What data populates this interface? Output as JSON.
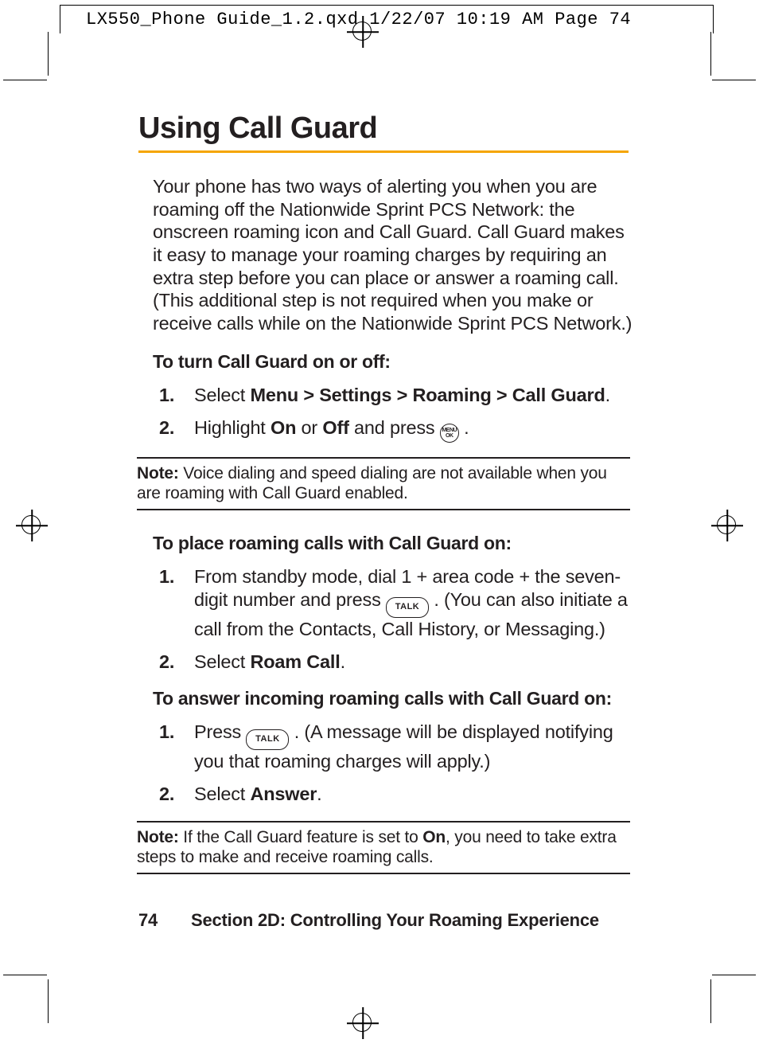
{
  "slug": "LX550_Phone Guide_1.2.qxd  1/22/07  10:19 AM  Page 74",
  "title": "Using Call Guard",
  "intro": "Your phone has two ways of alerting you when you are roaming off the Nationwide Sprint PCS Network: the onscreen roaming icon and Call Guard. Call Guard makes it easy to manage your roaming charges by requiring an extra step before you can place or answer a roaming call. (This additional step is not required when you make or receive calls while on the Nationwide Sprint PCS Network.)",
  "subhead_turn": "To turn Call Guard on or off:",
  "steps_turn": {
    "s1_pre": "Select ",
    "s1_bold": "Menu > Settings > Roaming > Call Guard",
    "s1_post": ".",
    "s2_pre": "Highlight ",
    "s2_b1": "On",
    "s2_mid": " or ",
    "s2_b2": "Off",
    "s2_post1": " and press ",
    "s2_post2": " ."
  },
  "note1": {
    "label": "Note:",
    "text": " Voice dialing and speed dialing are not available when you are roaming with Call Guard enabled."
  },
  "subhead_place": "To place roaming calls with Call Guard on:",
  "steps_place": {
    "s1_pre": "From standby mode, dial 1 + area code + the seven-digit number and press ",
    "s1_post": " . (You can also initiate a call from the Contacts, Call History, or Messaging.)",
    "s2_pre": "Select ",
    "s2_bold": "Roam Call",
    "s2_post": "."
  },
  "subhead_answer": "To answer incoming roaming calls with Call Guard on:",
  "steps_answer": {
    "s1_pre": "Press ",
    "s1_post": " . (A message will be displayed notifying you that roaming charges will apply.)",
    "s2_pre": "Select ",
    "s2_bold": "Answer",
    "s2_post": "."
  },
  "note2": {
    "label": "Note:",
    "pre": " If the Call Guard feature is set to ",
    "bold": "On",
    "post": ", you need to take extra steps to make and receive roaming calls."
  },
  "footer": {
    "page": "74",
    "section": "Section 2D: Controlling Your Roaming Experience"
  },
  "key_labels": {
    "menu_top": "MENU",
    "menu_bot": "OK",
    "talk": "TALK"
  }
}
